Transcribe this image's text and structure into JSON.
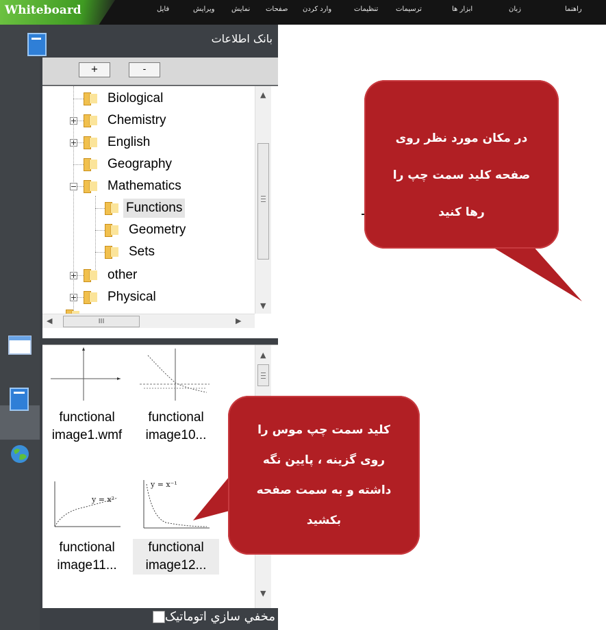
{
  "app": {
    "brand": "Whiteboard"
  },
  "menu": [
    "فایل",
    "ویرایش",
    "نمایش",
    "صفحات",
    "وارد کردن",
    "تنظیمات",
    "ترسیمات",
    "ابزار ها",
    "زبان",
    "راهنما"
  ],
  "panel": {
    "title": "بانک اطلاعات",
    "toolbar": {
      "add_label": "+",
      "remove_label": "-"
    },
    "tree": [
      {
        "label": "Biological",
        "expandable": false
      },
      {
        "label": "Chemistry",
        "expandable": true
      },
      {
        "label": "English",
        "expandable": true
      },
      {
        "label": "Geography",
        "expandable": false
      },
      {
        "label": "Mathematics",
        "expandable": true,
        "expanded": true
      },
      {
        "label": "Functions",
        "child": true,
        "selected": true
      },
      {
        "label": "Geometry",
        "child": true
      },
      {
        "label": "Sets",
        "child": true
      },
      {
        "label": "other",
        "expandable": true
      },
      {
        "label": "Physical",
        "expandable": true
      }
    ],
    "hscroll_grip": "III",
    "thumbnails": [
      {
        "line1": "functional",
        "line2": "image1.wmf"
      },
      {
        "line1": "functional",
        "line2": "image10..."
      },
      {
        "line1": "functional",
        "line2": "image11..."
      },
      {
        "line1": "functional",
        "line2": "image12...",
        "highlighted": true
      }
    ],
    "thumb_equations": {
      "third": "y = x²",
      "fourth": "y = x⁻¹"
    },
    "autohide_label": "مخفي سازي اتوماتيک"
  },
  "callouts": {
    "top": [
      "در مکان مورد نظر روی",
      "صفحه کلید سمت چپ را",
      "رها کنید"
    ],
    "bottom": [
      "کلید سمت چپ موس را",
      "روی گزینه ، پایین نگه",
      "داشته و به سمت صفحه",
      "بکشید"
    ]
  },
  "colors": {
    "callout": "#b11f24",
    "panel": "#3c4045",
    "topbar": "#141414",
    "brand": "#4fae2c"
  }
}
